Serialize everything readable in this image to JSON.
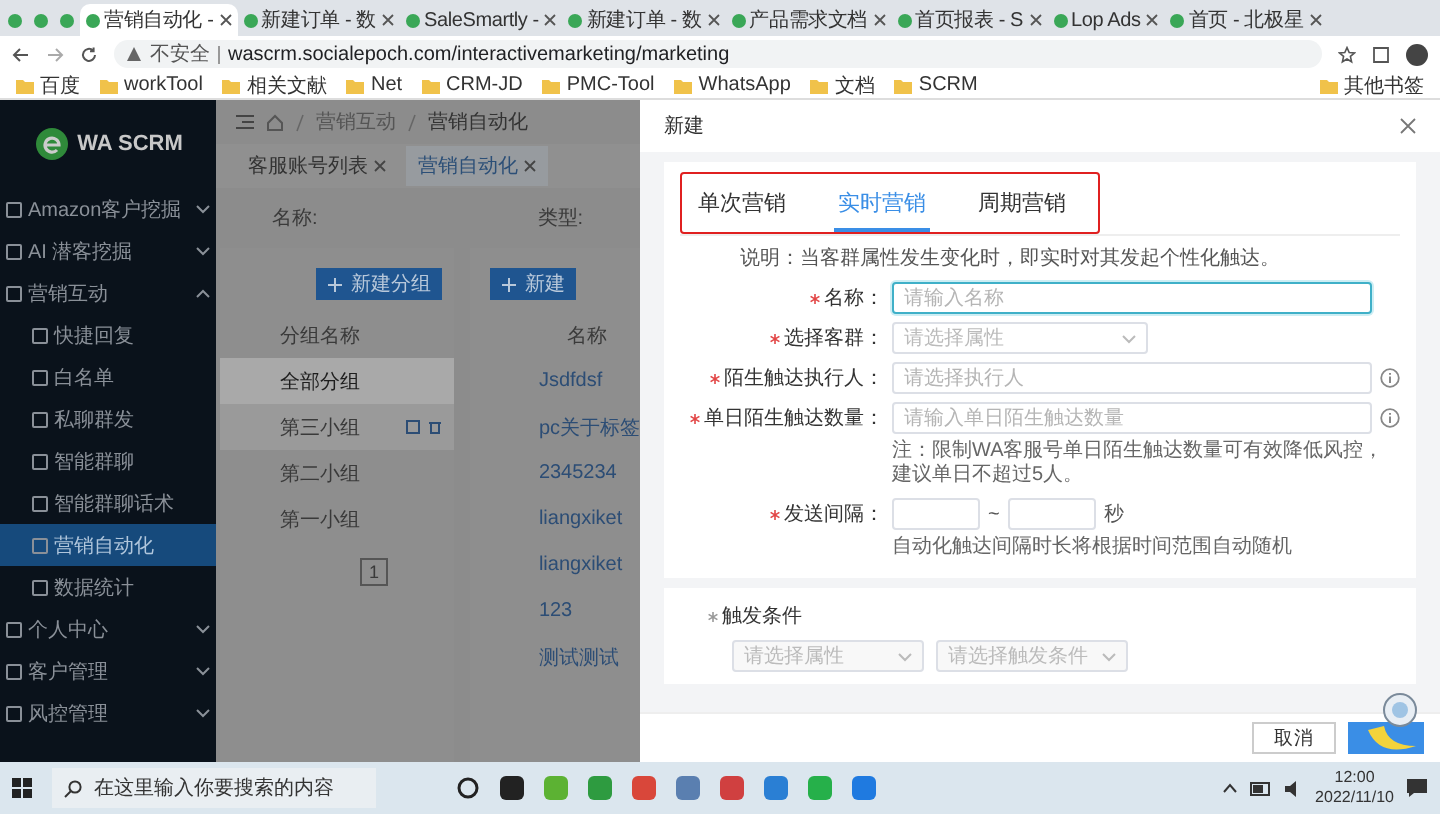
{
  "browser": {
    "tabs": [
      {
        "selected": false
      },
      {
        "selected": false
      },
      {
        "selected": false
      },
      {
        "title": "营销自动化 -",
        "selected": true
      },
      {
        "title": "新建订单 - 数",
        "selected": false
      },
      {
        "title": "SaleSmartly -",
        "selected": false
      },
      {
        "title": "新建订单 - 数",
        "selected": false
      },
      {
        "title": "产品需求文档",
        "selected": false
      },
      {
        "title": "首页报表 - S",
        "selected": false
      },
      {
        "title": "Lop Ads",
        "selected": false
      },
      {
        "title": "首页 - 北极星",
        "selected": false
      }
    ],
    "security_label": "不安全",
    "url": "wascrm.socialepoch.com/interactivemarketing/marketing",
    "bookmarks": [
      "百度",
      "workTool",
      "相关文献",
      "Net",
      "CRM-JD",
      "PMC-Tool",
      "WhatsApp",
      "文档",
      "SCRM"
    ],
    "other_bookmarks": "其他书签"
  },
  "sidebar": {
    "logo": "WA SCRM",
    "items": [
      {
        "label": "Amazon客户挖掘",
        "expanded": false
      },
      {
        "label": "AI 潜客挖掘",
        "expanded": false
      },
      {
        "label": "营销互动",
        "expanded": true,
        "children": [
          {
            "label": "快捷回复",
            "selected": false
          },
          {
            "label": "白名单",
            "selected": false
          },
          {
            "label": "私聊群发",
            "selected": false
          },
          {
            "label": "智能群聊",
            "selected": false
          },
          {
            "label": "智能群聊话术",
            "selected": false
          },
          {
            "label": "营销自动化",
            "selected": true
          },
          {
            "label": "数据统计",
            "selected": false
          }
        ]
      },
      {
        "label": "个人中心",
        "expanded": false
      },
      {
        "label": "客户管理",
        "expanded": false
      },
      {
        "label": "风控管理",
        "expanded": false
      }
    ]
  },
  "main": {
    "breadcrumb": [
      "营销互动",
      "营销自动化"
    ],
    "page_tabs": [
      {
        "label": "客服账号列表",
        "selected": false
      },
      {
        "label": "营销自动化",
        "selected": true
      }
    ],
    "filters": [
      "名称:",
      "类型:"
    ],
    "group_panel": {
      "add_button": "新建分组",
      "header": "分组名称",
      "page": "1",
      "rows": [
        {
          "label": "全部分组",
          "selected": true,
          "hovered": false
        },
        {
          "label": "第三小组",
          "selected": false,
          "hovered": true
        },
        {
          "label": "第二小组",
          "selected": false,
          "hovered": false
        },
        {
          "label": "第一小组",
          "selected": false,
          "hovered": false
        }
      ]
    },
    "list_panel": {
      "add_button": "新建",
      "header": "名称",
      "rows": [
        "Jsdfdsf",
        "pc关于标签",
        "2345234",
        "liangxiket",
        "liangxiket",
        "123",
        "测试测试"
      ]
    }
  },
  "drawer": {
    "title": "新建",
    "tabs": [
      {
        "label": "单次营销",
        "selected": false
      },
      {
        "label": "实时营销",
        "selected": true
      },
      {
        "label": "周期营销",
        "selected": false
      }
    ],
    "description": "说明：当客群属性发生变化时，即实时对其发起个性化触达。",
    "fields": [
      {
        "kind": "input",
        "label": "名称：",
        "required": true,
        "placeholder": "请输入名称",
        "focused": true,
        "info": false
      },
      {
        "kind": "select",
        "label": "选择客群：",
        "required": true,
        "placeholder": "请选择属性",
        "focused": false,
        "info": false
      },
      {
        "kind": "input",
        "label": "陌生触达执行人：",
        "required": true,
        "placeholder": "请选择执行人",
        "focused": false,
        "info": true
      },
      {
        "kind": "input",
        "label": "单日陌生触达数量：",
        "required": true,
        "placeholder": "请输入单日陌生触达数量",
        "focused": false,
        "info": true,
        "note": "注：限制WA客服号单日陌生触达数量可有效降低风控，建议单日不超过5人。"
      },
      {
        "kind": "range",
        "label": "发送间隔：",
        "required": true,
        "separator": "~",
        "unit": "秒",
        "focused": false,
        "info": false,
        "note": "自动化触达间隔时长将根据时间范围自动随机"
      }
    ],
    "trigger": {
      "title": "触发条件",
      "selects": [
        "请选择属性",
        "请选择触发条件"
      ]
    },
    "cancel_button": "取消"
  },
  "taskbar": {
    "search_placeholder": "在这里输入你要搜索的内容",
    "time": "12:00",
    "date": "2022/11/10"
  }
}
